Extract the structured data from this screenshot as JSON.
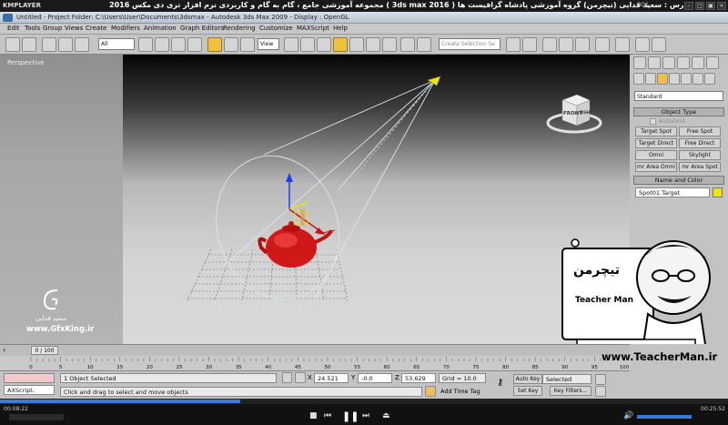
{
  "player": {
    "logo": "KMPLAYER",
    "title": "مجموعه آموزشی جامع ، گام به گام و کاربردی نرم افزار تری دی مکس 2016 ( 3ds max 2016 )  مدرس : سعید فدایی (تیچرمن) گروه آموزشی پادشاه گرافیست ها",
    "box_label": "BOX",
    "time_elapsed": "00:08:22",
    "time_total": "00:25:52",
    "progress_fraction": 0.33,
    "accent_color": "#3b7be0"
  },
  "window": {
    "title": "Untitled     - Project Folder: C:\\Users\\User\\Documents\\3dsmax      - Autodesk 3ds Max  2009        - Display : OpenGL"
  },
  "menu": [
    "Edit",
    "Tools",
    "Group",
    "Views",
    "Create",
    "Modifiers",
    "Animation",
    "Graph Editors",
    "Rendering",
    "Customize",
    "MAXScript",
    "Help"
  ],
  "toolbar": {
    "selection_filter": "All",
    "ref_coord": "View",
    "named_selection_placeholder": "Create Selection Se"
  },
  "viewport": {
    "label": "Perspective",
    "viewcube_face": "FRONT",
    "viewcube_side": "RIGHT"
  },
  "command_panel": {
    "category_dropdown": "Standard",
    "object_type_header": "Object Type",
    "autogrid_label": "AutoGrid",
    "buttons": [
      "Target Spot",
      "Free Spot",
      "Target Direct",
      "Free Direct",
      "Omni",
      "Skylight",
      "mr Area Omni",
      "mr Area Spot"
    ],
    "name_color_header": "Name and Color",
    "object_name": "Spot01.Target",
    "object_color": "#f2e600"
  },
  "timeline": {
    "frame_display": "0 / 100",
    "ticks": [
      "0",
      "5",
      "10",
      "15",
      "20",
      "25",
      "30",
      "35",
      "40",
      "45",
      "50",
      "55",
      "60",
      "65",
      "70",
      "75",
      "80",
      "85",
      "90",
      "95",
      "100"
    ]
  },
  "status": {
    "maxscript_label": "AXScript.",
    "selection_status": "1 Object Selected",
    "prompt": "Click and drag to select and move objects",
    "x_label": "X",
    "x_value": "24.521",
    "y_label": "Y",
    "y_value": "-0.0",
    "z_label": "Z",
    "z_value": "53.629",
    "grid": "Grid = 10.0",
    "add_time_tag": "Add Time Tag"
  },
  "anim_controls": {
    "auto_key": "Auto Key",
    "selected": "Selected",
    "set_key": "Set Key",
    "key_filters": "Key Filters..."
  },
  "watermarks": {
    "gfxking_name": "سعید فدایی",
    "gfxking_url": "www.GfxKing.ir",
    "teacherman_url": "www.TeacherMan.ir",
    "teacherman_logo_persian": "تیچرمن",
    "teacherman_logo_english": "Teacher Man"
  }
}
